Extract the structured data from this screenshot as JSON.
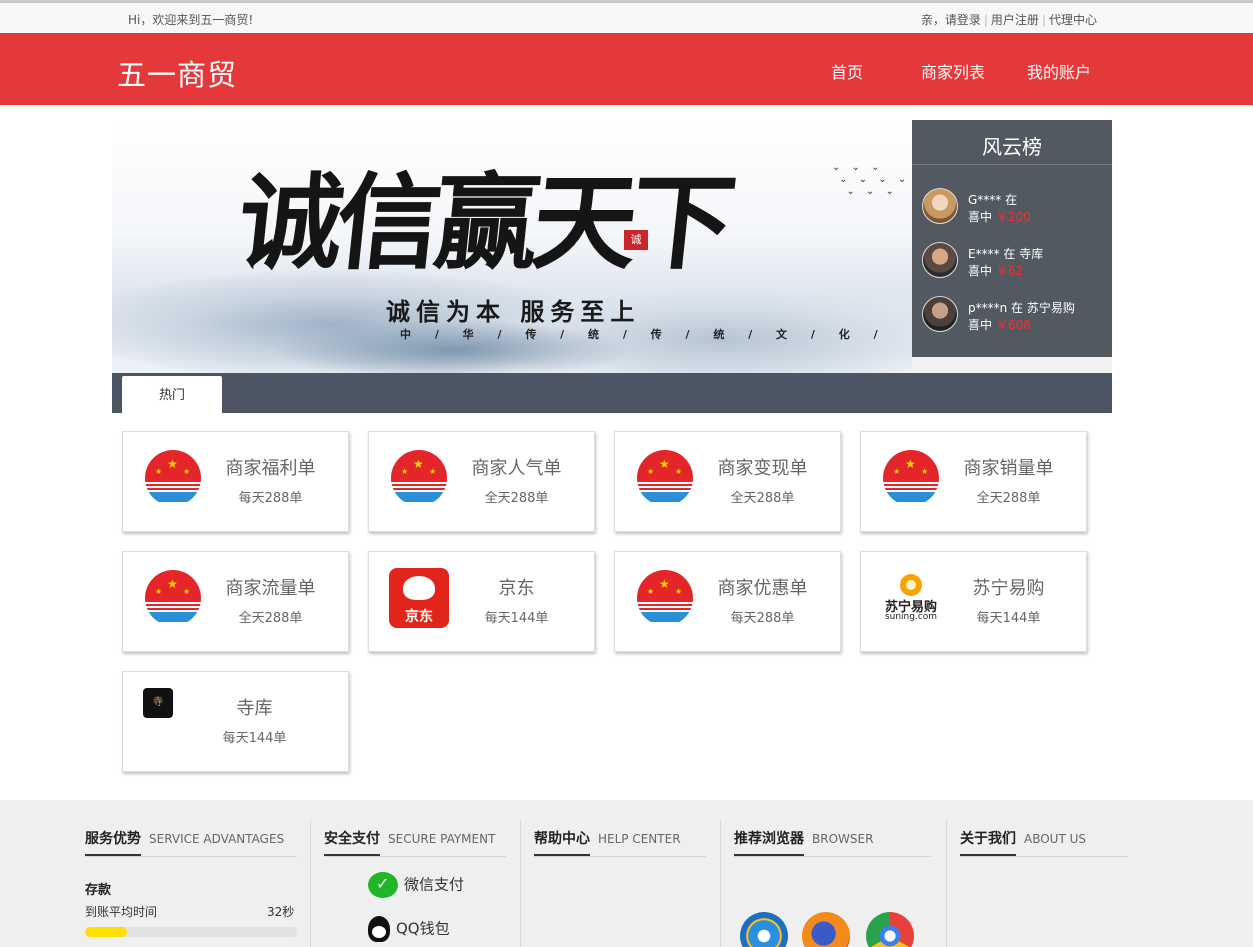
{
  "topbar": {
    "welcome": "Hi，欢迎来到五一商贸!",
    "login": "亲，请登录",
    "register": "用户注册",
    "agent": "代理中心"
  },
  "header": {
    "brand": "五一商贸",
    "nav": [
      "首页",
      "商家列表",
      "我的账户"
    ]
  },
  "banner": {
    "headline": "诚信赢天下",
    "seal": "诚",
    "slogan": "诚信为本  服务至上",
    "tagline": "中 / 华 / 传 / 统 /     传 / 统 / 文 / 化 /"
  },
  "ranking": {
    "title": "风云榜",
    "items": [
      {
        "user": "G**** 在",
        "won": "喜中",
        "amount": "￥200"
      },
      {
        "user": "E**** 在 寺库",
        "won": "喜中",
        "amount": "￥62"
      },
      {
        "user": "p****n 在 苏宁易购",
        "won": "喜中",
        "amount": "￥608"
      }
    ]
  },
  "tabs": [
    "热门"
  ],
  "cards": [
    {
      "name": "商家福利单",
      "sub": "每天288单",
      "logo": "emblem-icon"
    },
    {
      "name": "商家人气单",
      "sub": "全天288单",
      "logo": "emblem-icon"
    },
    {
      "name": "商家变现单",
      "sub": "全天288单",
      "logo": "emblem-icon"
    },
    {
      "name": "商家销量单",
      "sub": "全天288单",
      "logo": "emblem-icon"
    },
    {
      "name": "商家流量单",
      "sub": "全天288单",
      "logo": "emblem-icon"
    },
    {
      "name": "京东",
      "sub": "每天144单",
      "logo": "jd-logo-icon",
      "logo_text": "京东"
    },
    {
      "name": "商家优惠单",
      "sub": "每天288单",
      "logo": "emblem-icon"
    },
    {
      "name": "苏宁易购",
      "sub": "每天144单",
      "logo": "suning-logo-icon",
      "logo_text": "苏宁易购",
      "logo_en": "suning.com"
    },
    {
      "name": "寺库",
      "sub": "每天144单",
      "logo": "siku-logo-icon"
    }
  ],
  "footer": {
    "service": {
      "title": "服务优势",
      "en": "SERVICE ADVANTAGES",
      "stat_label": "存款",
      "stat_name": "到账平均时间",
      "stat_value": "32秒",
      "stat_fraction": 0.2
    },
    "payment": {
      "title": "安全支付",
      "en": "SECURE PAYMENT",
      "methods": [
        "微信支付",
        "QQ钱包"
      ]
    },
    "help": {
      "title": "帮助中心",
      "en": "HELP CENTER"
    },
    "browser": {
      "title": "推荐浏览器",
      "en": "BROWSER",
      "icons": [
        "ie-icon",
        "firefox-icon",
        "chrome-icon"
      ]
    },
    "about": {
      "title": "关于我们",
      "en": "ABOUT US"
    }
  },
  "colors": {
    "brand_red": "#e5383b",
    "tab_bar": "#4b5564",
    "rank_bg": "#535960",
    "amount_red": "#ff2a2a",
    "progress": "#ffe100"
  }
}
